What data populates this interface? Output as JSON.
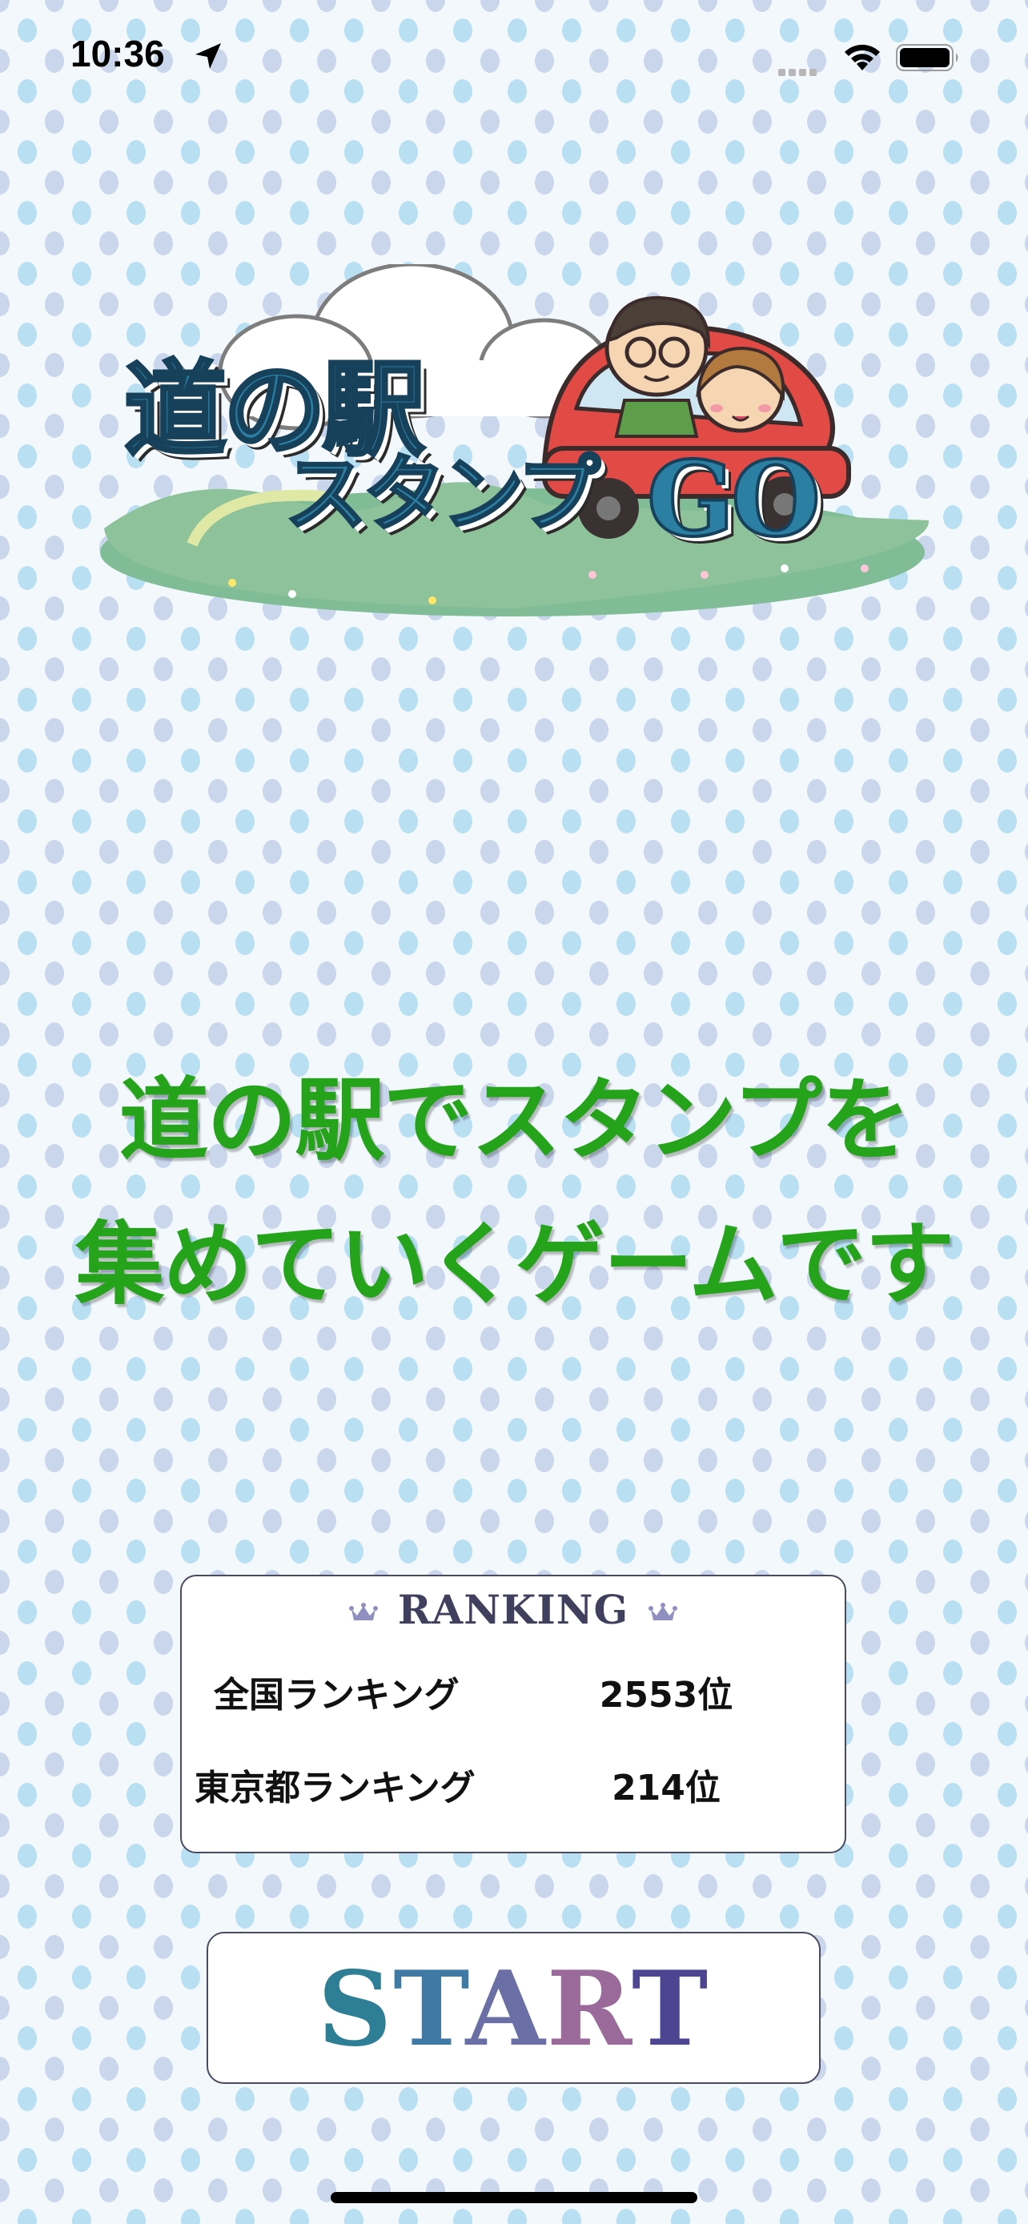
{
  "status_bar": {
    "time": "10:36"
  },
  "logo": {
    "title_main": "道の駅",
    "title_sub": "スタンプ",
    "title_go": "GO"
  },
  "tagline": {
    "line1": "道の駅でスタンプを",
    "line2": "集めていくゲームです"
  },
  "ranking": {
    "header": "RANKING",
    "rows": [
      {
        "label": "全国ランキング",
        "value": "2553位"
      },
      {
        "label": "東京都ランキング",
        "value": "214位"
      }
    ]
  },
  "start_button": {
    "letters": [
      "S",
      "T",
      "A",
      "R",
      "T"
    ]
  },
  "colors": {
    "tagline_green": "#25a31b",
    "logo_blue": "#2a7fa3",
    "card_border": "#4a4a63",
    "dot_blue": "#b9dff3",
    "dot_lavender": "#c9d6ec"
  },
  "icons": {
    "status": [
      "location-arrow-icon",
      "cellular-signal-icon",
      "wifi-icon",
      "battery-icon"
    ],
    "ranking": [
      "crown-icon"
    ]
  }
}
